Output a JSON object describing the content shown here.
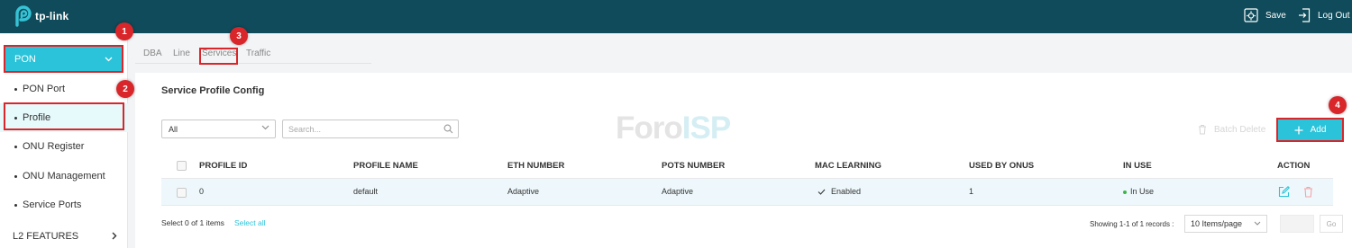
{
  "header": {
    "brand": "tp-link",
    "save_label": "Save",
    "logout_label": "Log Out"
  },
  "sidebar": {
    "section_label": "PON",
    "items": [
      {
        "label": "PON Port"
      },
      {
        "label": "Profile"
      },
      {
        "label": "ONU Register"
      },
      {
        "label": "ONU Management"
      },
      {
        "label": "Service Ports"
      }
    ],
    "next_section_label": "L2 FEATURES"
  },
  "tabs": [
    "DBA",
    "Line",
    "Services",
    "Traffic"
  ],
  "annotations": [
    "1",
    "2",
    "3",
    "4"
  ],
  "main": {
    "title": "Service Profile Config",
    "filter_value": "All",
    "search_placeholder": "Search...",
    "watermark": {
      "part1": "Foro",
      "part2": "ISP"
    },
    "batch_delete_label": "Batch Delete",
    "add_label": "Add"
  },
  "table": {
    "columns": [
      "PROFILE ID",
      "PROFILE NAME",
      "ETH NUMBER",
      "POTS NUMBER",
      "MAC LEARNING",
      "USED BY ONUS",
      "IN USE",
      "ACTION"
    ],
    "rows": [
      {
        "profile_id": "0",
        "profile_name": "default",
        "eth_number": "Adaptive",
        "pots_number": "Adaptive",
        "mac_learning": "Enabled",
        "used_by_onus": "1",
        "in_use": "In Use"
      }
    ]
  },
  "footer": {
    "selected_text": "Select 0 of 1 items",
    "select_all_label": "Select all",
    "showing_text": "Showing 1-1 of 1 records :",
    "per_page_value": "10 Items/page",
    "go_label": "Go"
  },
  "colors": {
    "header_bg": "#0f4b5a",
    "accent": "#2bc3d9",
    "annotation_red": "#d9262a",
    "in_use_green": "#3bb54a"
  }
}
